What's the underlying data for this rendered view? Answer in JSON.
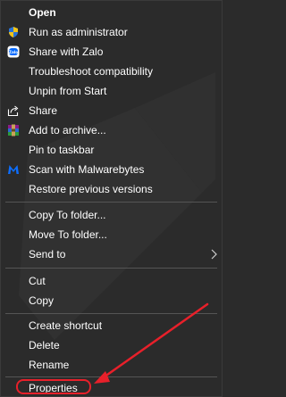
{
  "menu": {
    "open": "Open",
    "run_as_admin": "Run as administrator",
    "share_zalo": "Share with Zalo",
    "troubleshoot": "Troubleshoot compatibility",
    "unpin_start": "Unpin from Start",
    "share": "Share",
    "add_archive": "Add to archive...",
    "pin_taskbar": "Pin to taskbar",
    "scan_malwarebytes": "Scan with Malwarebytes",
    "restore_versions": "Restore previous versions",
    "copy_to_folder": "Copy To folder...",
    "move_to_folder": "Move To folder...",
    "send_to": "Send to",
    "cut": "Cut",
    "copy": "Copy",
    "create_shortcut": "Create shortcut",
    "delete": "Delete",
    "rename": "Rename",
    "properties": "Properties"
  },
  "icons": {
    "run_as_admin": "shield-icon",
    "share_zalo": "zalo-icon",
    "share": "share-icon",
    "add_archive": "winrar-icon",
    "scan_malwarebytes": "malwarebytes-icon",
    "send_to": "chevron-right-icon"
  },
  "colors": {
    "background": "#2b2b2b",
    "text": "#ffffff",
    "separator": "#555555",
    "annotation": "#e8202a",
    "zalo": "#0068ff",
    "malwarebytes": "#0d6efd"
  }
}
